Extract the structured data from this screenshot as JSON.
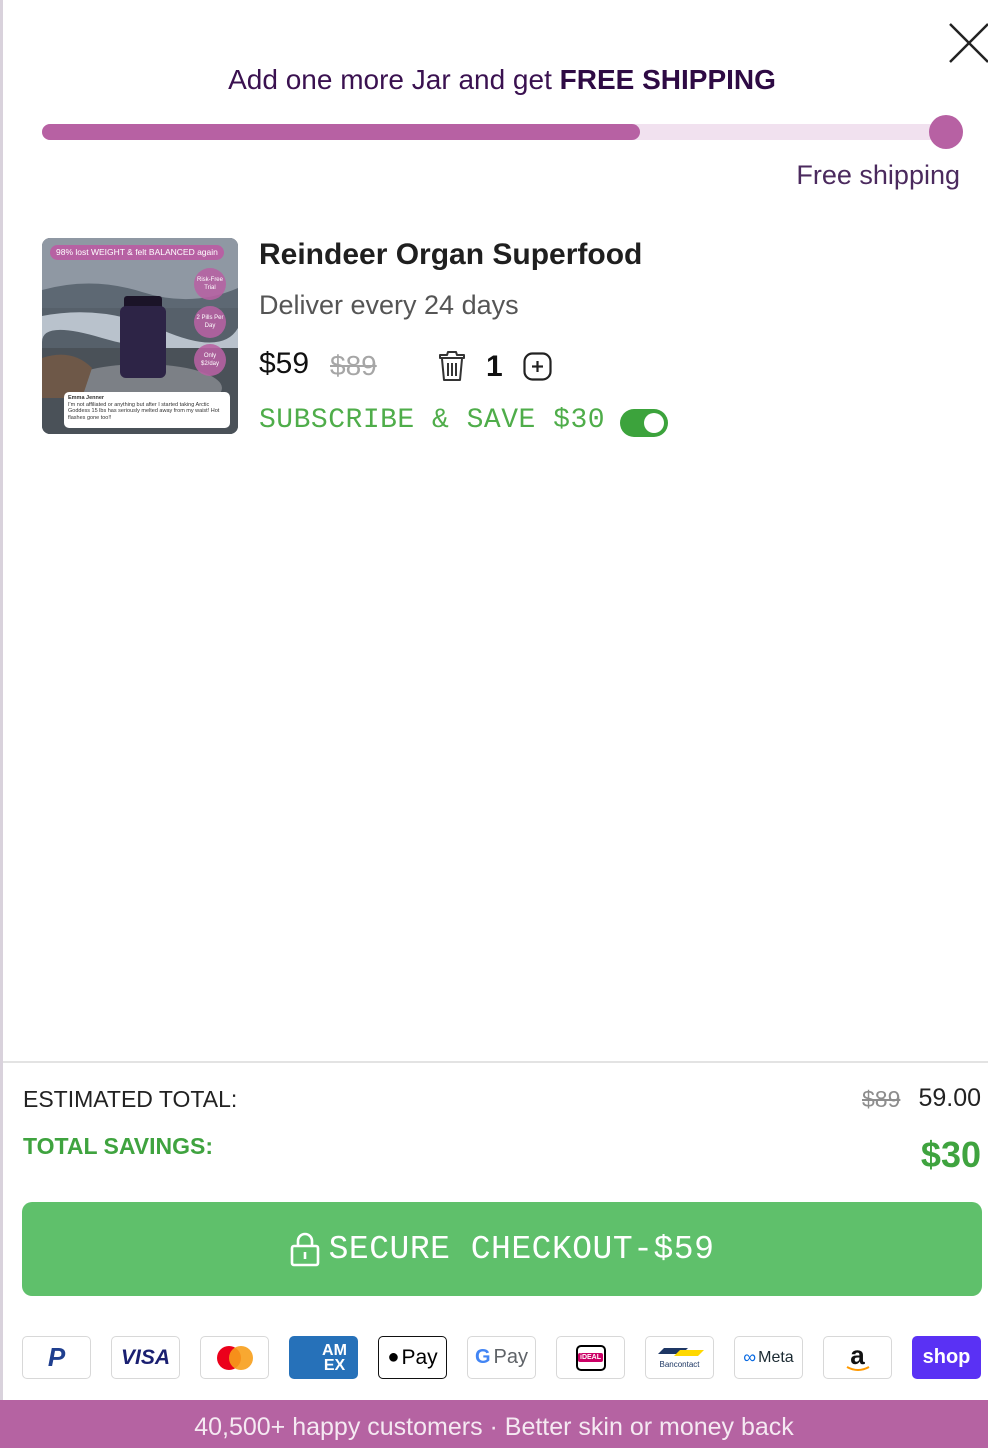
{
  "shipping": {
    "message_prefix": "Add one more Jar and get",
    "message_highlight": "FREE SHIPPING",
    "progress_fraction": 0.66,
    "caption": "Free shipping"
  },
  "product": {
    "title": "Reindeer Organ Superfood",
    "delivery": "Deliver every 24 days",
    "price": "$59",
    "compare_price": "$89",
    "quantity": "1",
    "subscribe_label": "SUBSCRIBE & SAVE $30",
    "subscribe_enabled": true,
    "image": {
      "banner": "98% lost WEIGHT & felt BALANCED again",
      "badges": [
        "Risk-Free Trial",
        "2 Pills Per Day",
        "Only $2/day"
      ],
      "review_name": "Emma Jenner",
      "review_text": "I'm not affiliated or anything but after I started taking Arctic Goddess 15 lbs has seriously melted away from my waist! Hot flashes gone too!!"
    }
  },
  "totals": {
    "estimated_label": "ESTIMATED TOTAL:",
    "estimated_was": "$89",
    "estimated_now": "59.00",
    "savings_label": "TOTAL SAVINGS:",
    "savings_amount": "$30"
  },
  "checkout": {
    "label": "SECURE CHECKOUT-$59"
  },
  "payment_methods": [
    {
      "name": "paypal",
      "label": "P"
    },
    {
      "name": "visa",
      "label": "VISA"
    },
    {
      "name": "mastercard",
      "label": ""
    },
    {
      "name": "amex",
      "label": "AM EX"
    },
    {
      "name": "apple-pay",
      "label": "Pay"
    },
    {
      "name": "google-pay",
      "label": "Pay"
    },
    {
      "name": "ideal",
      "label": "iDEAL"
    },
    {
      "name": "bancontact",
      "label": "Bancontact"
    },
    {
      "name": "meta-pay",
      "label": "Meta"
    },
    {
      "name": "amazon-pay",
      "label": "a"
    },
    {
      "name": "shop-pay",
      "label": "shop"
    }
  ],
  "colors": {
    "accent_purple": "#b761a3",
    "progress_track": "#f1e1ef",
    "success_green": "#3fa33f",
    "checkout_green": "#5fc06b",
    "heading_purple": "#3a1150"
  },
  "footer": {
    "text": "40,500+ happy customers · Better skin or money back"
  }
}
